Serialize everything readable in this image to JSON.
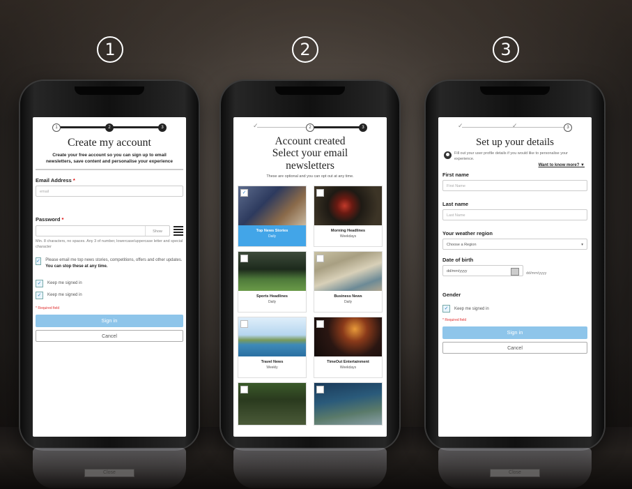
{
  "steps": [
    "1",
    "2",
    "3"
  ],
  "phone1": {
    "progress": [
      "1",
      "2",
      "3"
    ],
    "title": "Create my account",
    "subtitle": "Create your free account so you can sign up to email newsletters, save content and personalise your experience",
    "email_label": "Email Address",
    "email_placeholder": "email",
    "password_label": "Password",
    "show_label": "Show",
    "password_hint": "Min. 8 characters, no spaces. Any 3 of number, lowercase/uppercase letter and special character",
    "marketing_text": "Please email me top news stories, competitions, offers and other updates.",
    "marketing_strong": "You can stop these at any time.",
    "keep_signed_in_1": "Keep me signed in",
    "keep_signed_in_2": "Keep me signed in",
    "required_note": "* Required field",
    "sign_in": "Sign in",
    "cancel": "Cancel",
    "asterisk": "*"
  },
  "phone2": {
    "progress": [
      "2",
      "3"
    ],
    "title_line1": "Account created",
    "title_line2": "Select your email",
    "title_line3": "newsletters",
    "subtitle": "These are optional and you can opt out at any time.",
    "newsletters": [
      {
        "name": "Top News Stories",
        "freq": "Daily",
        "selected": true
      },
      {
        "name": "Morning Headlines",
        "freq": "Weekdays",
        "selected": false
      },
      {
        "name": "Sports Headlines",
        "freq": "Daily",
        "selected": false
      },
      {
        "name": "Business News",
        "freq": "Daily",
        "selected": false
      },
      {
        "name": "Travel News",
        "freq": "Weekly",
        "selected": false
      },
      {
        "name": "TimeOut Entertainment",
        "freq": "Weekdays",
        "selected": false
      }
    ]
  },
  "phone3": {
    "progress": [
      "3"
    ],
    "title": "Set up your details",
    "info": "Fill out your user profile details if you would like to personalise your experience.",
    "want_more": "Want to know more?",
    "first_name_label": "First name",
    "first_name_placeholder": "First Name",
    "last_name_label": "Last name",
    "last_name_placeholder": "Last Name",
    "region_label": "Your weather region",
    "region_value": "Choose a Region",
    "dob_label": "Date of birth",
    "dob_placeholder": "dd/mm/yyyy",
    "dob_format": "dd/mm/yyyy",
    "gender_label": "Gender",
    "keep_signed_in": "Keep me signed in",
    "required_note": "* Required field",
    "sign_in": "Sign in",
    "cancel": "Cancel"
  },
  "reflection_label": "Close"
}
